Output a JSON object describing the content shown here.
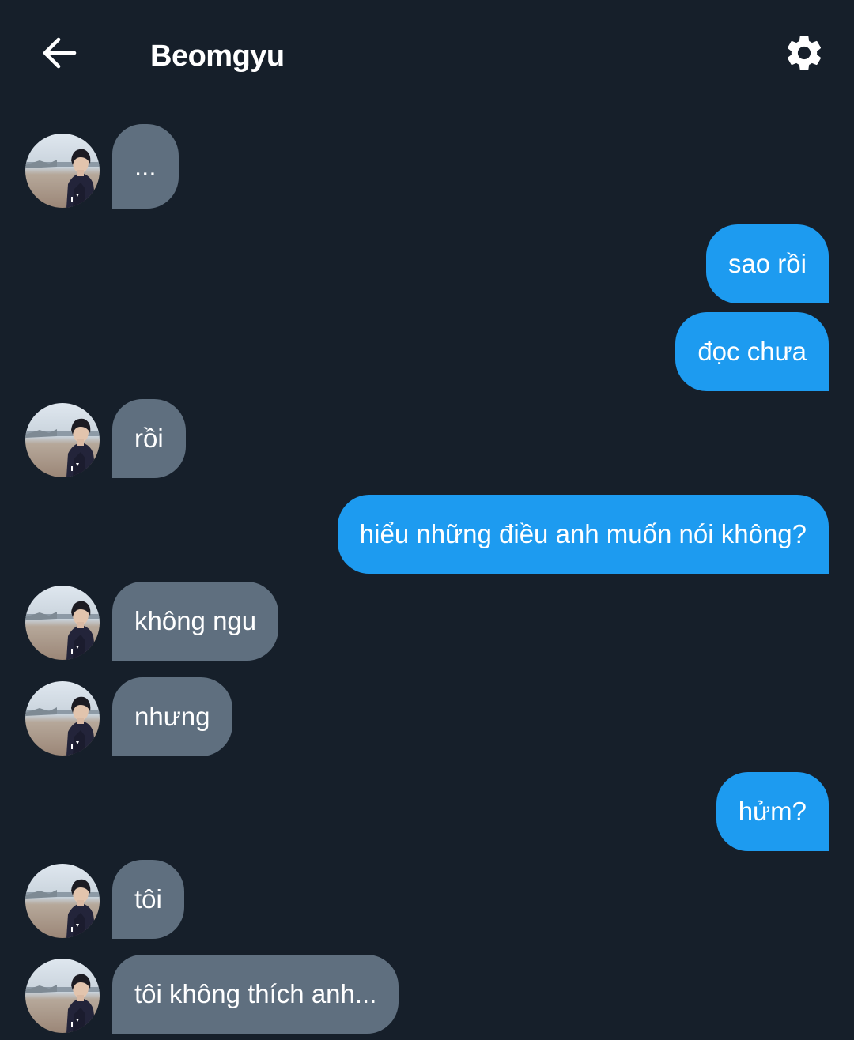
{
  "header": {
    "title": "Beomgyu",
    "back_icon": "arrow-left-icon",
    "settings_icon": "gear-icon"
  },
  "colors": {
    "background": "#161f2a",
    "incoming_bubble": "#5f6f7f",
    "outgoing_bubble": "#1d9bf0",
    "text": "#ffffff"
  },
  "messages": [
    {
      "sender": "Beomgyu",
      "direction": "incoming",
      "text": "..."
    },
    {
      "sender": "me",
      "direction": "outgoing",
      "text": "sao rồi"
    },
    {
      "sender": "me",
      "direction": "outgoing",
      "text": "đọc chưa"
    },
    {
      "sender": "Beomgyu",
      "direction": "incoming",
      "text": "rồi"
    },
    {
      "sender": "me",
      "direction": "outgoing",
      "text": "hiểu những điều anh muốn nói không?"
    },
    {
      "sender": "Beomgyu",
      "direction": "incoming",
      "text": "không ngu"
    },
    {
      "sender": "Beomgyu",
      "direction": "incoming",
      "text": "nhưng"
    },
    {
      "sender": "me",
      "direction": "outgoing",
      "text": "hửm?"
    },
    {
      "sender": "Beomgyu",
      "direction": "incoming",
      "text": "tôi"
    },
    {
      "sender": "Beomgyu",
      "direction": "incoming",
      "text": "tôi không thích anh..."
    }
  ]
}
